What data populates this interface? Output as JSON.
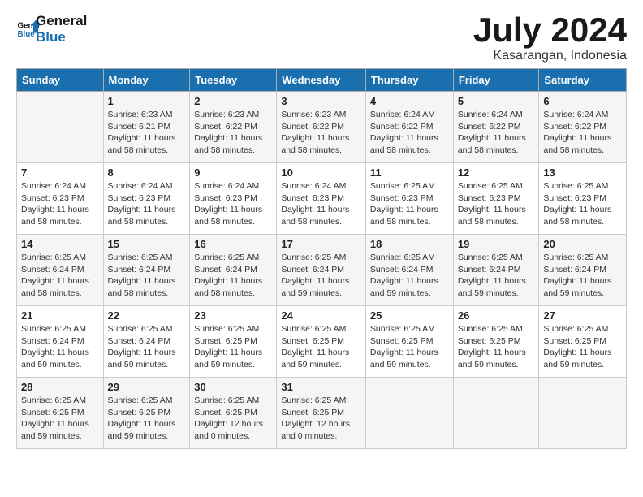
{
  "logo": {
    "line1": "General",
    "line2": "Blue"
  },
  "header": {
    "month": "July 2024",
    "location": "Kasarangan, Indonesia"
  },
  "weekdays": [
    "Sunday",
    "Monday",
    "Tuesday",
    "Wednesday",
    "Thursday",
    "Friday",
    "Saturday"
  ],
  "weeks": [
    [
      {
        "day": "",
        "sunrise": "",
        "sunset": "",
        "daylight": ""
      },
      {
        "day": "1",
        "sunrise": "6:23 AM",
        "sunset": "6:21 PM",
        "daylight": "11 hours and 58 minutes."
      },
      {
        "day": "2",
        "sunrise": "6:23 AM",
        "sunset": "6:22 PM",
        "daylight": "11 hours and 58 minutes."
      },
      {
        "day": "3",
        "sunrise": "6:23 AM",
        "sunset": "6:22 PM",
        "daylight": "11 hours and 58 minutes."
      },
      {
        "day": "4",
        "sunrise": "6:24 AM",
        "sunset": "6:22 PM",
        "daylight": "11 hours and 58 minutes."
      },
      {
        "day": "5",
        "sunrise": "6:24 AM",
        "sunset": "6:22 PM",
        "daylight": "11 hours and 58 minutes."
      },
      {
        "day": "6",
        "sunrise": "6:24 AM",
        "sunset": "6:22 PM",
        "daylight": "11 hours and 58 minutes."
      }
    ],
    [
      {
        "day": "7",
        "sunrise": "6:24 AM",
        "sunset": "6:23 PM",
        "daylight": "11 hours and 58 minutes."
      },
      {
        "day": "8",
        "sunrise": "6:24 AM",
        "sunset": "6:23 PM",
        "daylight": "11 hours and 58 minutes."
      },
      {
        "day": "9",
        "sunrise": "6:24 AM",
        "sunset": "6:23 PM",
        "daylight": "11 hours and 58 minutes."
      },
      {
        "day": "10",
        "sunrise": "6:24 AM",
        "sunset": "6:23 PM",
        "daylight": "11 hours and 58 minutes."
      },
      {
        "day": "11",
        "sunrise": "6:25 AM",
        "sunset": "6:23 PM",
        "daylight": "11 hours and 58 minutes."
      },
      {
        "day": "12",
        "sunrise": "6:25 AM",
        "sunset": "6:23 PM",
        "daylight": "11 hours and 58 minutes."
      },
      {
        "day": "13",
        "sunrise": "6:25 AM",
        "sunset": "6:23 PM",
        "daylight": "11 hours and 58 minutes."
      }
    ],
    [
      {
        "day": "14",
        "sunrise": "6:25 AM",
        "sunset": "6:24 PM",
        "daylight": "11 hours and 58 minutes."
      },
      {
        "day": "15",
        "sunrise": "6:25 AM",
        "sunset": "6:24 PM",
        "daylight": "11 hours and 58 minutes."
      },
      {
        "day": "16",
        "sunrise": "6:25 AM",
        "sunset": "6:24 PM",
        "daylight": "11 hours and 58 minutes."
      },
      {
        "day": "17",
        "sunrise": "6:25 AM",
        "sunset": "6:24 PM",
        "daylight": "11 hours and 59 minutes."
      },
      {
        "day": "18",
        "sunrise": "6:25 AM",
        "sunset": "6:24 PM",
        "daylight": "11 hours and 59 minutes."
      },
      {
        "day": "19",
        "sunrise": "6:25 AM",
        "sunset": "6:24 PM",
        "daylight": "11 hours and 59 minutes."
      },
      {
        "day": "20",
        "sunrise": "6:25 AM",
        "sunset": "6:24 PM",
        "daylight": "11 hours and 59 minutes."
      }
    ],
    [
      {
        "day": "21",
        "sunrise": "6:25 AM",
        "sunset": "6:24 PM",
        "daylight": "11 hours and 59 minutes."
      },
      {
        "day": "22",
        "sunrise": "6:25 AM",
        "sunset": "6:24 PM",
        "daylight": "11 hours and 59 minutes."
      },
      {
        "day": "23",
        "sunrise": "6:25 AM",
        "sunset": "6:25 PM",
        "daylight": "11 hours and 59 minutes."
      },
      {
        "day": "24",
        "sunrise": "6:25 AM",
        "sunset": "6:25 PM",
        "daylight": "11 hours and 59 minutes."
      },
      {
        "day": "25",
        "sunrise": "6:25 AM",
        "sunset": "6:25 PM",
        "daylight": "11 hours and 59 minutes."
      },
      {
        "day": "26",
        "sunrise": "6:25 AM",
        "sunset": "6:25 PM",
        "daylight": "11 hours and 59 minutes."
      },
      {
        "day": "27",
        "sunrise": "6:25 AM",
        "sunset": "6:25 PM",
        "daylight": "11 hours and 59 minutes."
      }
    ],
    [
      {
        "day": "28",
        "sunrise": "6:25 AM",
        "sunset": "6:25 PM",
        "daylight": "11 hours and 59 minutes."
      },
      {
        "day": "29",
        "sunrise": "6:25 AM",
        "sunset": "6:25 PM",
        "daylight": "11 hours and 59 minutes."
      },
      {
        "day": "30",
        "sunrise": "6:25 AM",
        "sunset": "6:25 PM",
        "daylight": "12 hours and 0 minutes."
      },
      {
        "day": "31",
        "sunrise": "6:25 AM",
        "sunset": "6:25 PM",
        "daylight": "12 hours and 0 minutes."
      },
      {
        "day": "",
        "sunrise": "",
        "sunset": "",
        "daylight": ""
      },
      {
        "day": "",
        "sunrise": "",
        "sunset": "",
        "daylight": ""
      },
      {
        "day": "",
        "sunrise": "",
        "sunset": "",
        "daylight": ""
      }
    ]
  ]
}
